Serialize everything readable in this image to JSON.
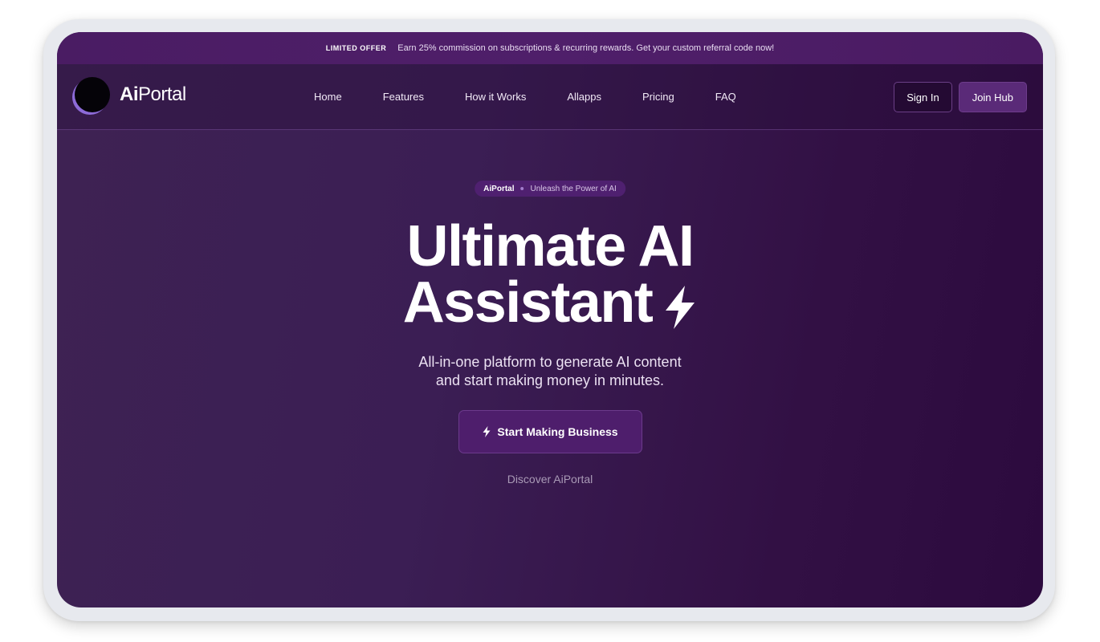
{
  "offer": {
    "tag": "LIMITED OFFER",
    "text": "Earn 25% commission on subscriptions & recurring rewards. Get your custom referral code now!"
  },
  "brand": {
    "name_bold": "Ai",
    "name_rest": "Portal"
  },
  "nav": {
    "items": [
      {
        "label": "Home"
      },
      {
        "label": "Features"
      },
      {
        "label": "How it Works"
      },
      {
        "label": "Allapps"
      },
      {
        "label": "Pricing"
      },
      {
        "label": "FAQ"
      }
    ],
    "sign_in": "Sign In",
    "join": "Join Hub"
  },
  "hero": {
    "badge_brand": "AiPortal",
    "badge_text": "Unleash the Power of AI",
    "title_line1": "Ultimate AI",
    "title_line2": "Assistant",
    "subtitle_line1": "All-in-one platform to generate AI content",
    "subtitle_line2": "and start making money in minutes.",
    "cta": "Start Making Business",
    "discover": "Discover AiPortal"
  },
  "icons": {
    "title_icon": "lightning-bolt-icon",
    "cta_icon": "lightning-bolt-icon"
  },
  "colors": {
    "background": "#3b1e54",
    "accent": "#5a2a78",
    "logo_ring": "#8d6bd8"
  }
}
